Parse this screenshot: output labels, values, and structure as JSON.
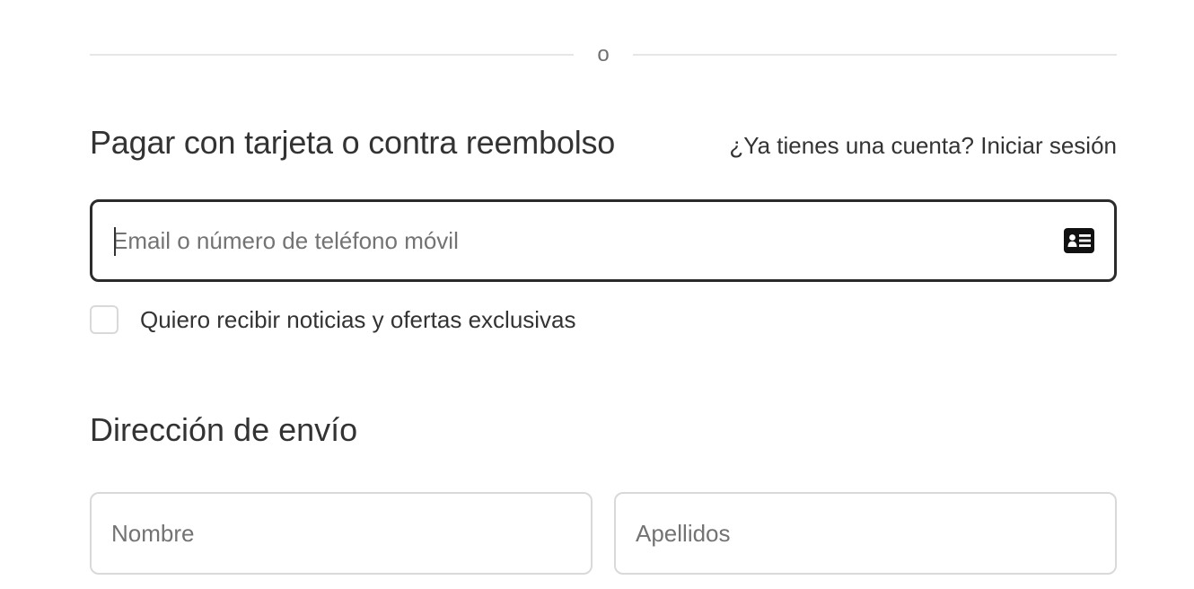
{
  "divider": {
    "text": "o"
  },
  "contact": {
    "title": "Pagar con tarjeta o contra reembolso",
    "login_prompt": "¿Ya tienes una cuenta?",
    "login_link": "Iniciar sesión",
    "input": {
      "placeholder": "Email o número de teléfono móvil",
      "value": "",
      "icon": "contact-card-icon"
    },
    "newsletter": {
      "label": "Quiero recibir noticias y ofertas exclusivas",
      "checked": false
    }
  },
  "shipping": {
    "title": "Dirección de envío",
    "first_name": {
      "placeholder": "Nombre",
      "value": ""
    },
    "last_name": {
      "placeholder": "Apellidos",
      "value": ""
    }
  },
  "colors": {
    "text": "#333333",
    "placeholder": "#737373",
    "border": "#d9d9d9",
    "focus_border": "#2b2b2b",
    "divider": "#e6e6e6"
  }
}
